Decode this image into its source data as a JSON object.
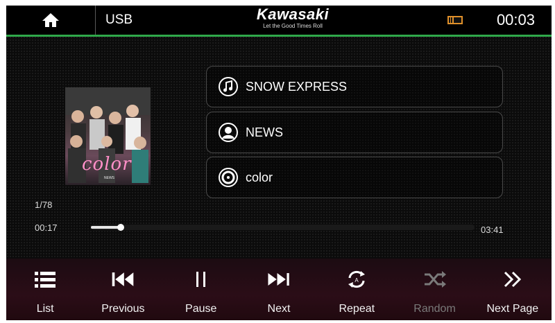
{
  "status_bar": {
    "source": "USB",
    "brand_name": "Kawasaki",
    "brand_tagline": "Let the Good Times Roll",
    "clock": "00:03",
    "icons": [
      "home-icon",
      "media-card-icon"
    ]
  },
  "now_playing": {
    "album_art_text": "color",
    "album_art_subtext": "NEWS",
    "title": "SNOW EXPRESS",
    "artist": "NEWS",
    "album": "color",
    "row_icons": [
      "music-note-icon",
      "artist-icon",
      "album-disc-icon"
    ]
  },
  "playback": {
    "track_index": "1/78",
    "elapsed": "00:17",
    "total": "03:41",
    "progress_fraction": 0.077
  },
  "controls": [
    {
      "label": "List",
      "icon": "list-icon",
      "enabled": true
    },
    {
      "label": "Previous",
      "icon": "previous-icon",
      "enabled": true
    },
    {
      "label": "Pause",
      "icon": "pause-icon",
      "enabled": true
    },
    {
      "label": "Next",
      "icon": "next-icon",
      "enabled": true
    },
    {
      "label": "Repeat",
      "icon": "repeat-icon",
      "enabled": true
    },
    {
      "label": "Random",
      "icon": "shuffle-icon",
      "enabled": false
    },
    {
      "label": "Next Page",
      "icon": "next-page-icon",
      "enabled": true
    }
  ],
  "colors": {
    "accent_green": "#2fa84a",
    "disabled_gray": "#7a7a7a",
    "bottom_bar": "#2b0d17"
  }
}
